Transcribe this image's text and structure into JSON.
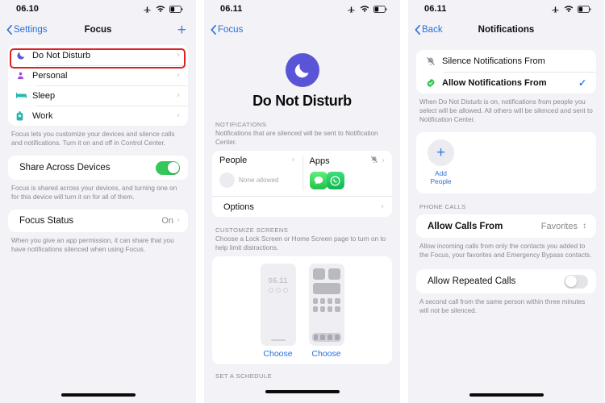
{
  "panels": [
    {
      "id": "focus-list",
      "status": {
        "time": "06.10",
        "icons": [
          "airplane-icon",
          "wifi-icon",
          "battery-icon"
        ]
      },
      "nav": {
        "back": "Settings",
        "title": "Focus",
        "add": "+"
      },
      "focus_items": [
        {
          "label": "Do Not Disturb",
          "icon": "moon-icon",
          "color": "#5a55d6",
          "highlighted": true
        },
        {
          "label": "Personal",
          "icon": "person-icon",
          "color": "#9b51e0",
          "highlighted": false
        },
        {
          "label": "Sleep",
          "icon": "bed-icon",
          "color": "#27b7ae",
          "highlighted": false
        },
        {
          "label": "Work",
          "icon": "briefcase-icon",
          "color": "#27b7ae",
          "highlighted": false
        }
      ],
      "focus_footnote": "Focus lets you customize your devices and silence calls and notifications. Turn it on and off in Control Center.",
      "share": {
        "label": "Share Across Devices",
        "state": "on"
      },
      "share_footnote": "Focus is shared across your devices, and turning one on for this device will turn it on for all of them.",
      "status_row": {
        "label": "Focus Status",
        "value": "On"
      },
      "status_footnote": "When you give an app permission, it can share that you have notifications silenced when using Focus."
    },
    {
      "id": "do-not-disturb-detail",
      "status": {
        "time": "06.11",
        "icons": [
          "airplane-icon",
          "wifi-icon",
          "battery-icon"
        ]
      },
      "nav": {
        "back": "Focus",
        "title": ""
      },
      "hero": {
        "title": "Do Not Disturb",
        "icon": "moon-icon",
        "color": "#5a55d6"
      },
      "notifications_header": "NOTIFICATIONS",
      "notifications_sub": "Notifications that are silenced will be sent to Notification Center.",
      "people_tile": {
        "label": "People",
        "empty_text": "None allowed"
      },
      "apps_tile": {
        "label": "Apps",
        "badge_icon": "bell-slash-icon",
        "apps": [
          "messages-icon",
          "whatsapp-icon"
        ]
      },
      "options_row": {
        "label": "Options"
      },
      "customize_header": "CUSTOMIZE SCREENS",
      "customize_sub": "Choose a Lock Screen or Home Screen page to turn on to help limit distractions.",
      "lock_preview": {
        "time": "06.11",
        "choose": "Choose"
      },
      "home_preview": {
        "choose": "Choose"
      },
      "schedule_header": "SET A SCHEDULE"
    },
    {
      "id": "notifications-detail",
      "status": {
        "time": "06.11",
        "icons": [
          "airplane-icon",
          "wifi-icon",
          "battery-icon"
        ]
      },
      "nav": {
        "back": "Back",
        "title": "Notifications"
      },
      "modes": [
        {
          "label": "Silence Notifications From",
          "icon": "bell-slash-icon",
          "selected": false
        },
        {
          "label": "Allow Notifications From",
          "icon": "check-badge-icon",
          "selected": true
        }
      ],
      "modes_footnote": "When Do Not Disturb is on, notifications from people you select will be allowed. All others will be silenced and sent to Notification Center.",
      "add_people": {
        "label": "Add People",
        "icon": "plus-icon"
      },
      "phone_calls_header": "PHONE CALLS",
      "allow_calls": {
        "label": "Allow Calls From",
        "value": "Favorites"
      },
      "allow_calls_footnote": "Allow incoming calls from only the contacts you added to the Focus, your favorites and Emergency Bypass contacts.",
      "repeated_calls": {
        "label": "Allow Repeated Calls",
        "state": "off"
      },
      "repeated_footnote": "A second call from the same person within three minutes will not be silenced."
    }
  ],
  "colors": {
    "accent_blue": "#2a6fd6",
    "toggle_on": "#34c759",
    "highlight_red": "#e02020",
    "dnd_purple": "#5a55d6",
    "background": "#f2f2f7"
  }
}
